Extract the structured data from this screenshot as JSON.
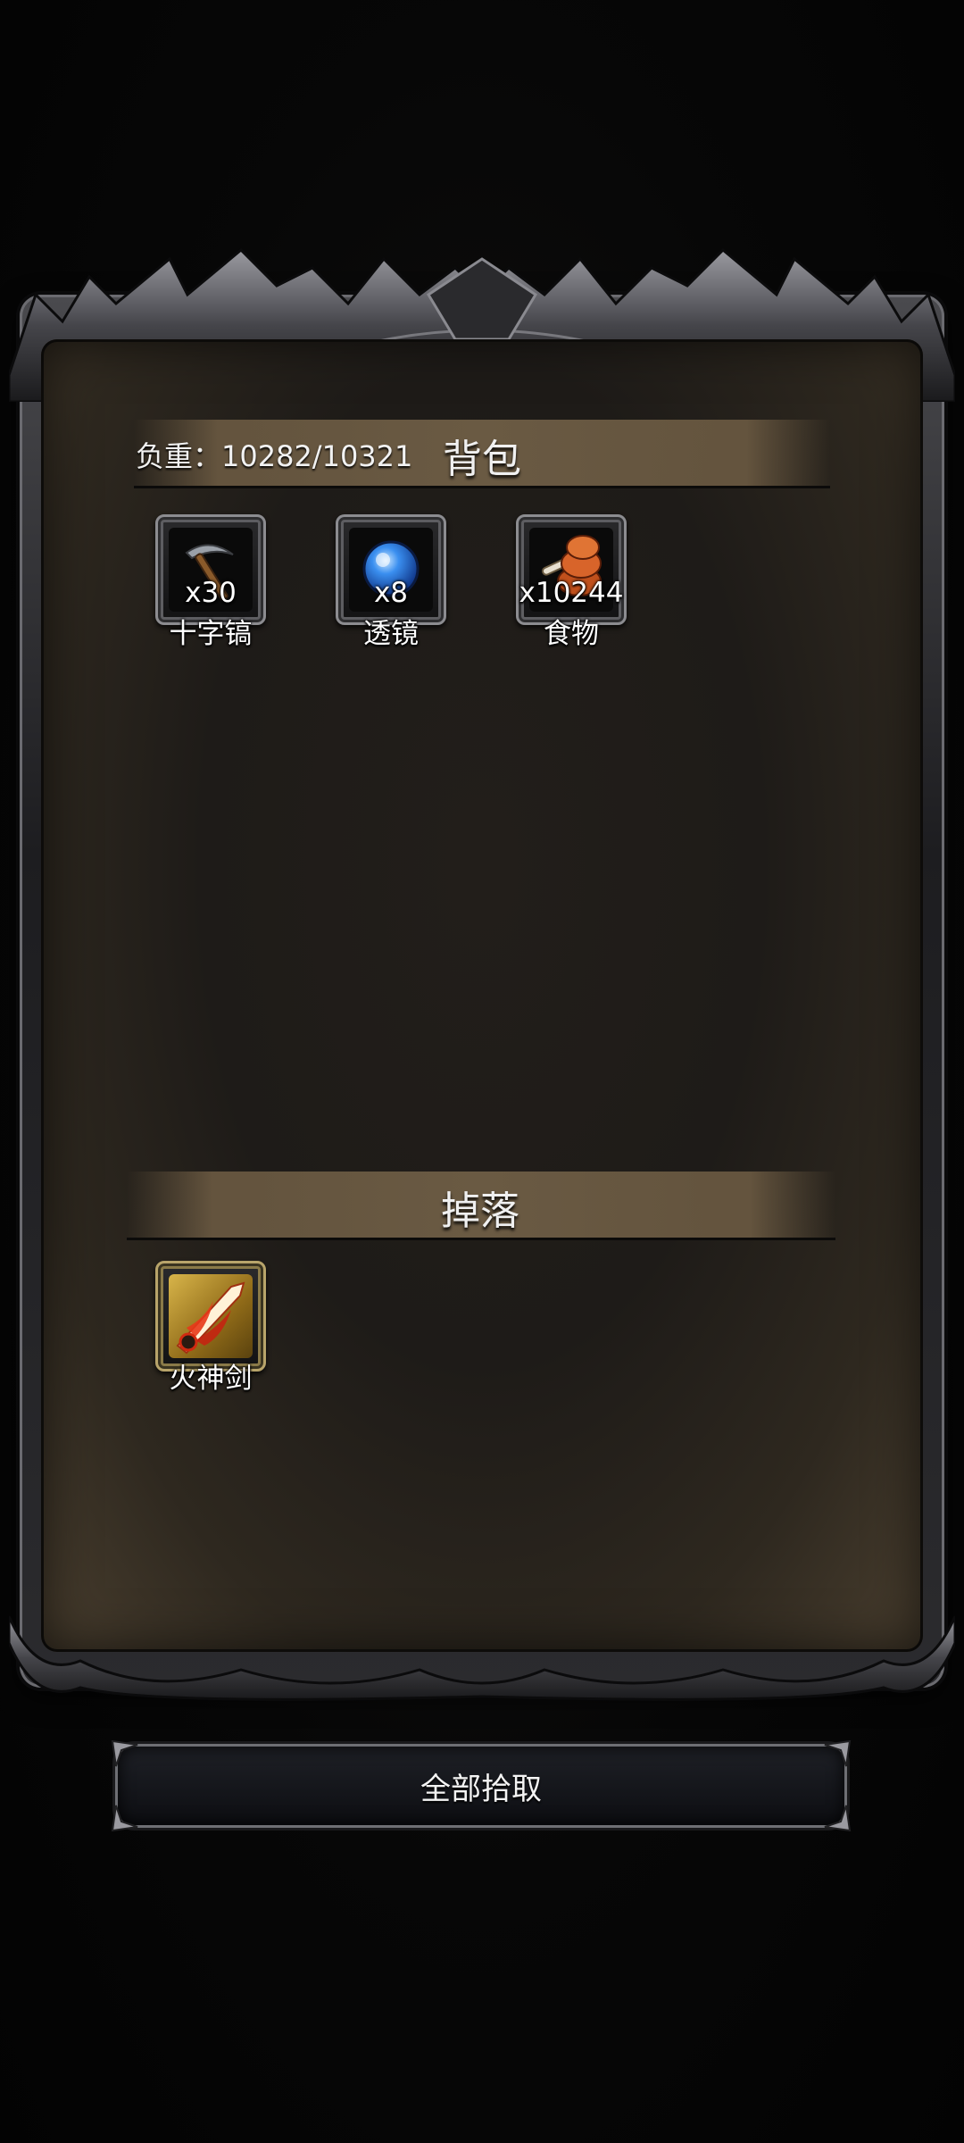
{
  "bag": {
    "weight_label": "负重：10282/10321",
    "title": "背包",
    "items": [
      {
        "name": "十字镐",
        "quantity": "x30",
        "icon": "pickaxe-icon"
      },
      {
        "name": "透镜",
        "quantity": "x8",
        "icon": "lens-icon"
      },
      {
        "name": "食物",
        "quantity": "x10244",
        "icon": "food-icon"
      }
    ]
  },
  "drops": {
    "title": "掉落",
    "items": [
      {
        "name": "火神剑",
        "icon": "fire-sword-icon"
      }
    ]
  },
  "actions": {
    "pickup_all_label": "全部拾取"
  },
  "colors": {
    "panel_bg": "#1e1b18",
    "header_bar": "#6a5a43",
    "frame_metal": "#4a4a4e",
    "rare_item_border": "#b8a46a"
  }
}
